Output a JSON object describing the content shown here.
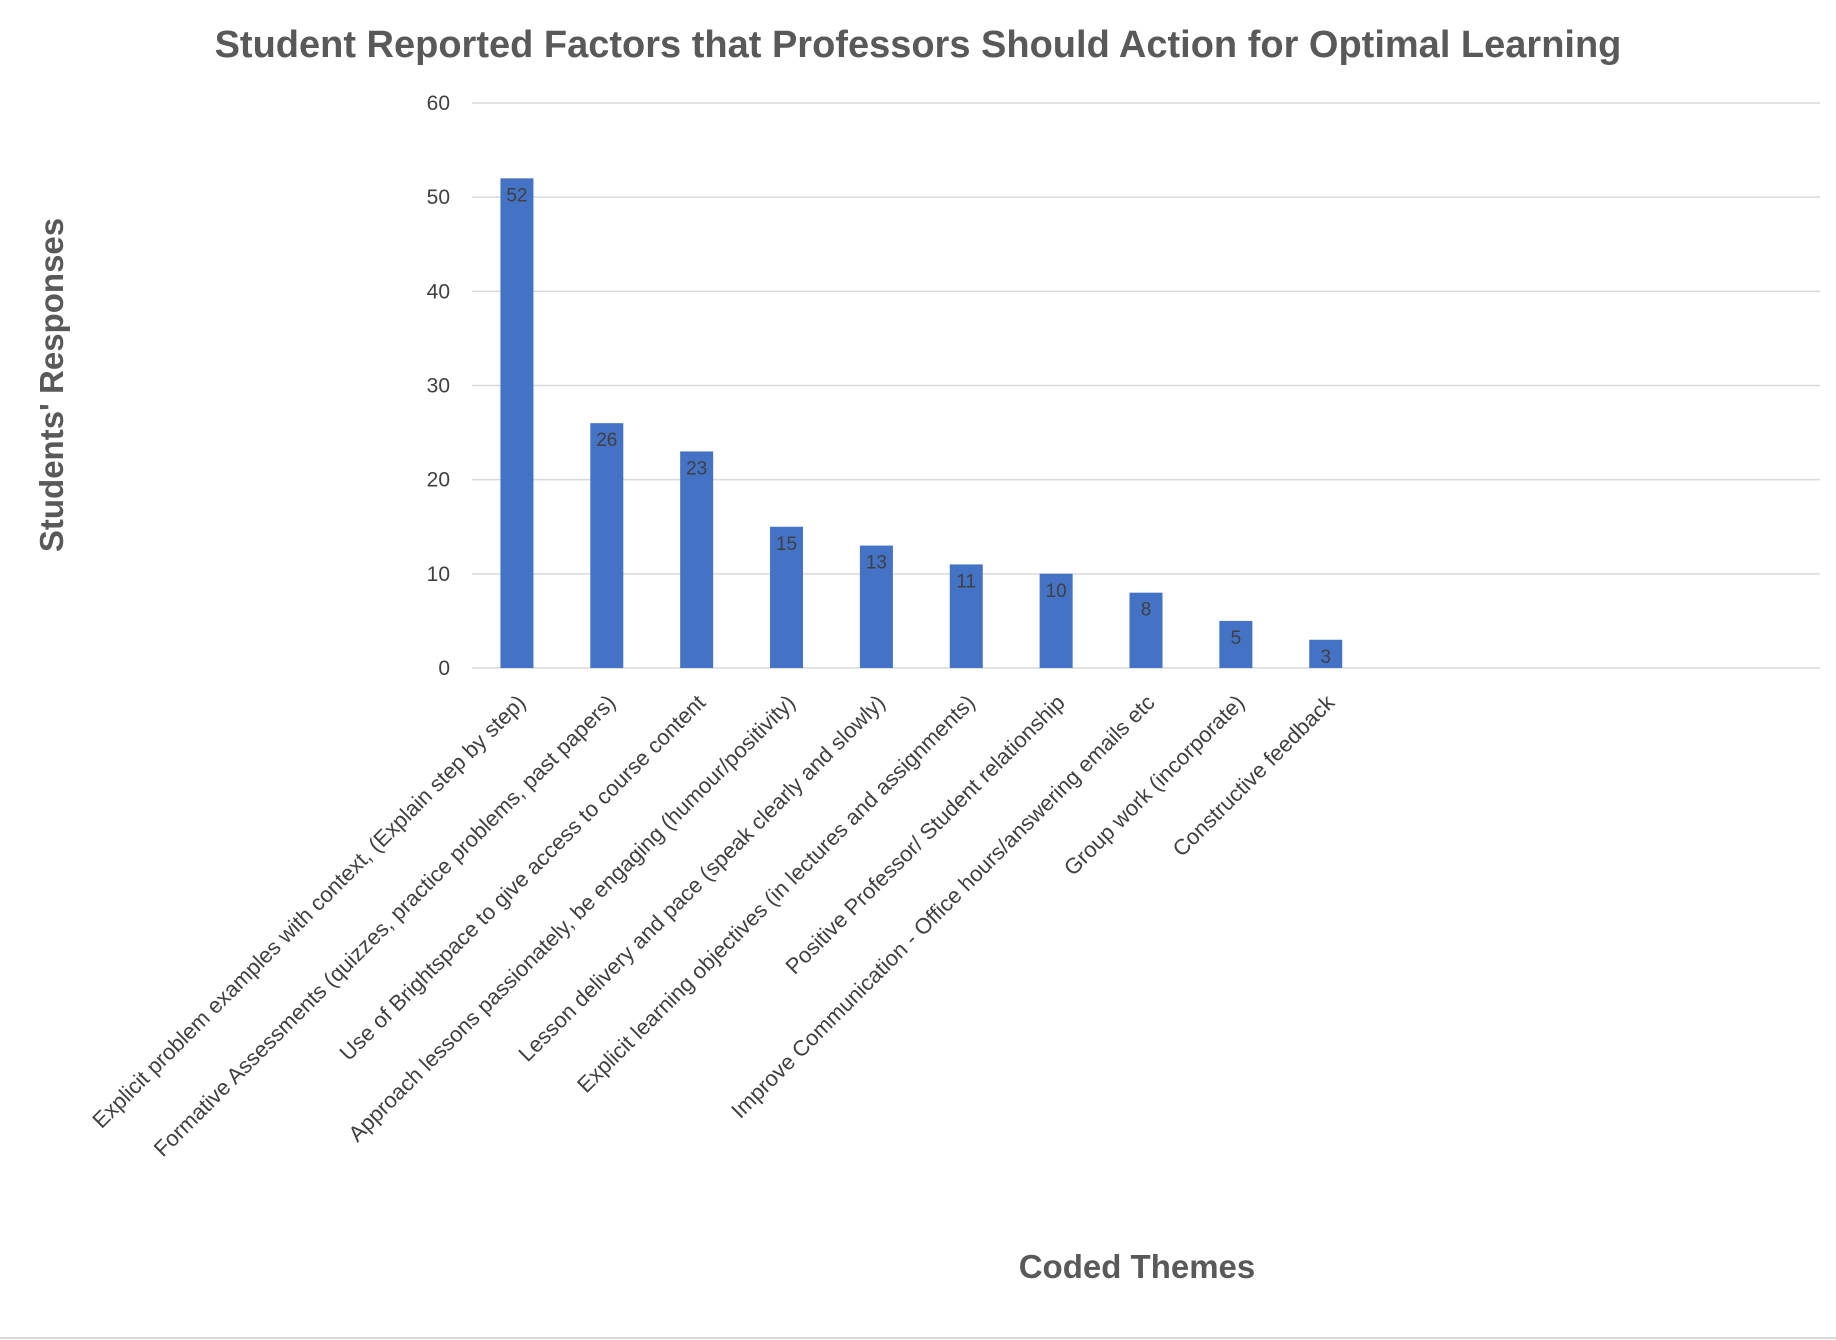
{
  "chart_data": {
    "type": "bar",
    "title": "Student Reported Factors that Professors Should Action for Optimal Learning",
    "xlabel": "Coded Themes",
    "ylabel": "Students' Responses",
    "categories": [
      "Explicit problem examples with context, (Explain step by step)",
      "Formative Assessments (quizzes, practice problems, past papers)",
      "Use of Brightspace to give access to course content",
      "Approach lessons passionately, be engaging (humour/positivity)",
      "Lesson delivery and pace (speak clearly and slowly)",
      "Explicit learning objectives (in lectures and assignments)",
      "Positive Professor/ Student relationship",
      "Improve Communication - Office hours/answering emails etc",
      "Group work (incorporate)",
      "Constructive feedback"
    ],
    "values": [
      52,
      26,
      23,
      15,
      13,
      11,
      10,
      8,
      5,
      3
    ],
    "ylim": [
      0,
      60
    ],
    "yticks": [
      0,
      10,
      20,
      30,
      40,
      50,
      60
    ],
    "grid": true,
    "legend": "none",
    "data_labels": true,
    "colors": {
      "bar": "#4472c4",
      "gridline": "#d9d9d9",
      "text": "#404040",
      "title": "#595959"
    }
  }
}
